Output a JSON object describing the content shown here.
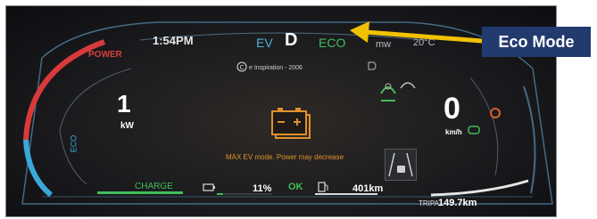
{
  "cluster": {
    "time": "1:54PM",
    "mode_ev": "EV",
    "gear": "D",
    "mode_eco": "ECO",
    "partial_top_value": "mw",
    "outside_temp": "20°C",
    "provider_line": "e Inspiration - 2006",
    "power_gauge_label": "POWER",
    "eco_gauge_label": "ECO",
    "power_value": "1",
    "power_unit": "kW",
    "speed_value": "0",
    "speed_unit": "km/h",
    "warning_message": "MAX EV mode. Power may decrease",
    "charge_label": "CHARGE",
    "battery_percent": "11%",
    "status_ok": "OK",
    "range_value": "401km",
    "odometer_label": "TRIPA",
    "odometer_value": "149.7km",
    "battery_level_fraction": 0.11
  },
  "annotation": {
    "label": "Eco Mode",
    "color": "#223a6e",
    "arrow_color": "#f2c200"
  },
  "colors": {
    "power_arc": "#d83a3a",
    "eco_arc": "#39a8d8",
    "ring": "#5a8fb0",
    "charge_green": "#3fbf5a",
    "warning_amber": "#e0912a"
  },
  "icons": {
    "battery_warning": "battery-warning-icon",
    "battery": "battery-icon",
    "fuel_pump": "fuel-pump-icon",
    "driver_assist": "driver-assist-icon",
    "lane_assist": "lane-assist-icon",
    "headlight": "headlight-icon",
    "copyright": "copyright-icon"
  }
}
